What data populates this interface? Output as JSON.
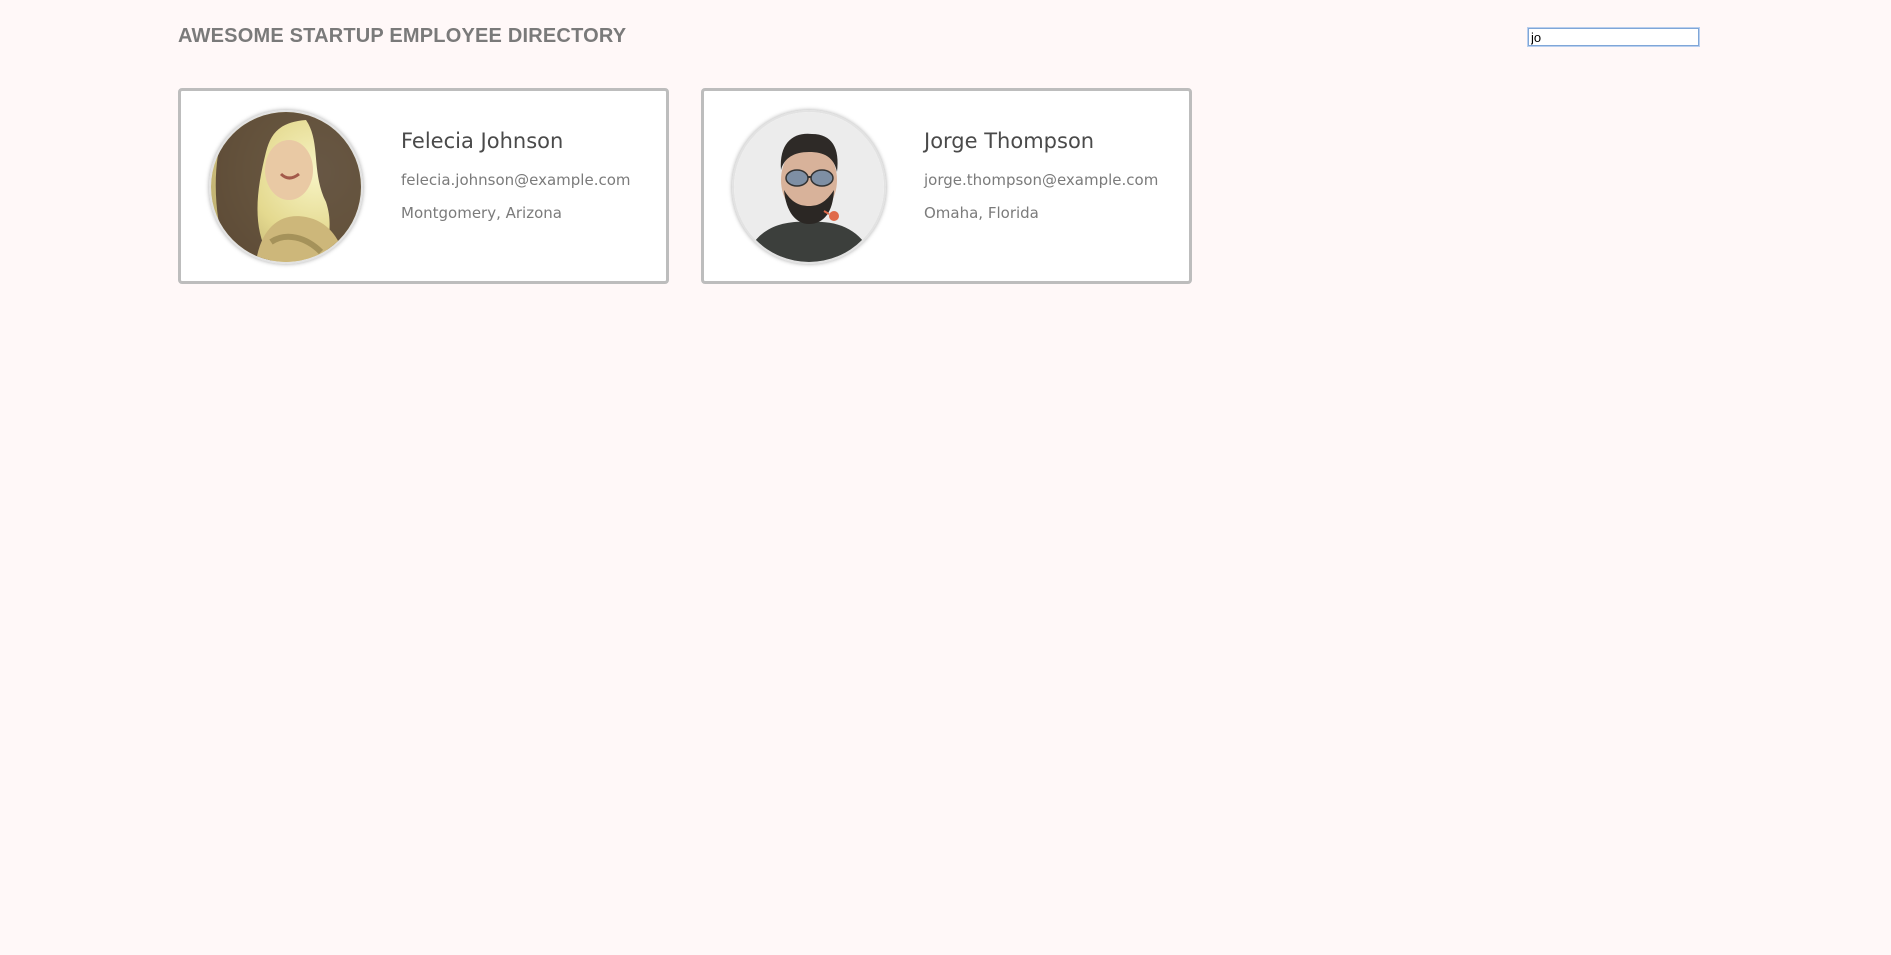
{
  "header": {
    "title": "AWESOME STARTUP EMPLOYEE DIRECTORY"
  },
  "search": {
    "value": "jo",
    "placeholder": ""
  },
  "employees": [
    {
      "name": "Felecia Johnson",
      "email": "felecia.johnson@example.com",
      "location": "Montgomery, Arizona"
    },
    {
      "name": "Jorge Thompson",
      "email": "jorge.thompson@example.com",
      "location": "Omaha, Florida"
    }
  ]
}
